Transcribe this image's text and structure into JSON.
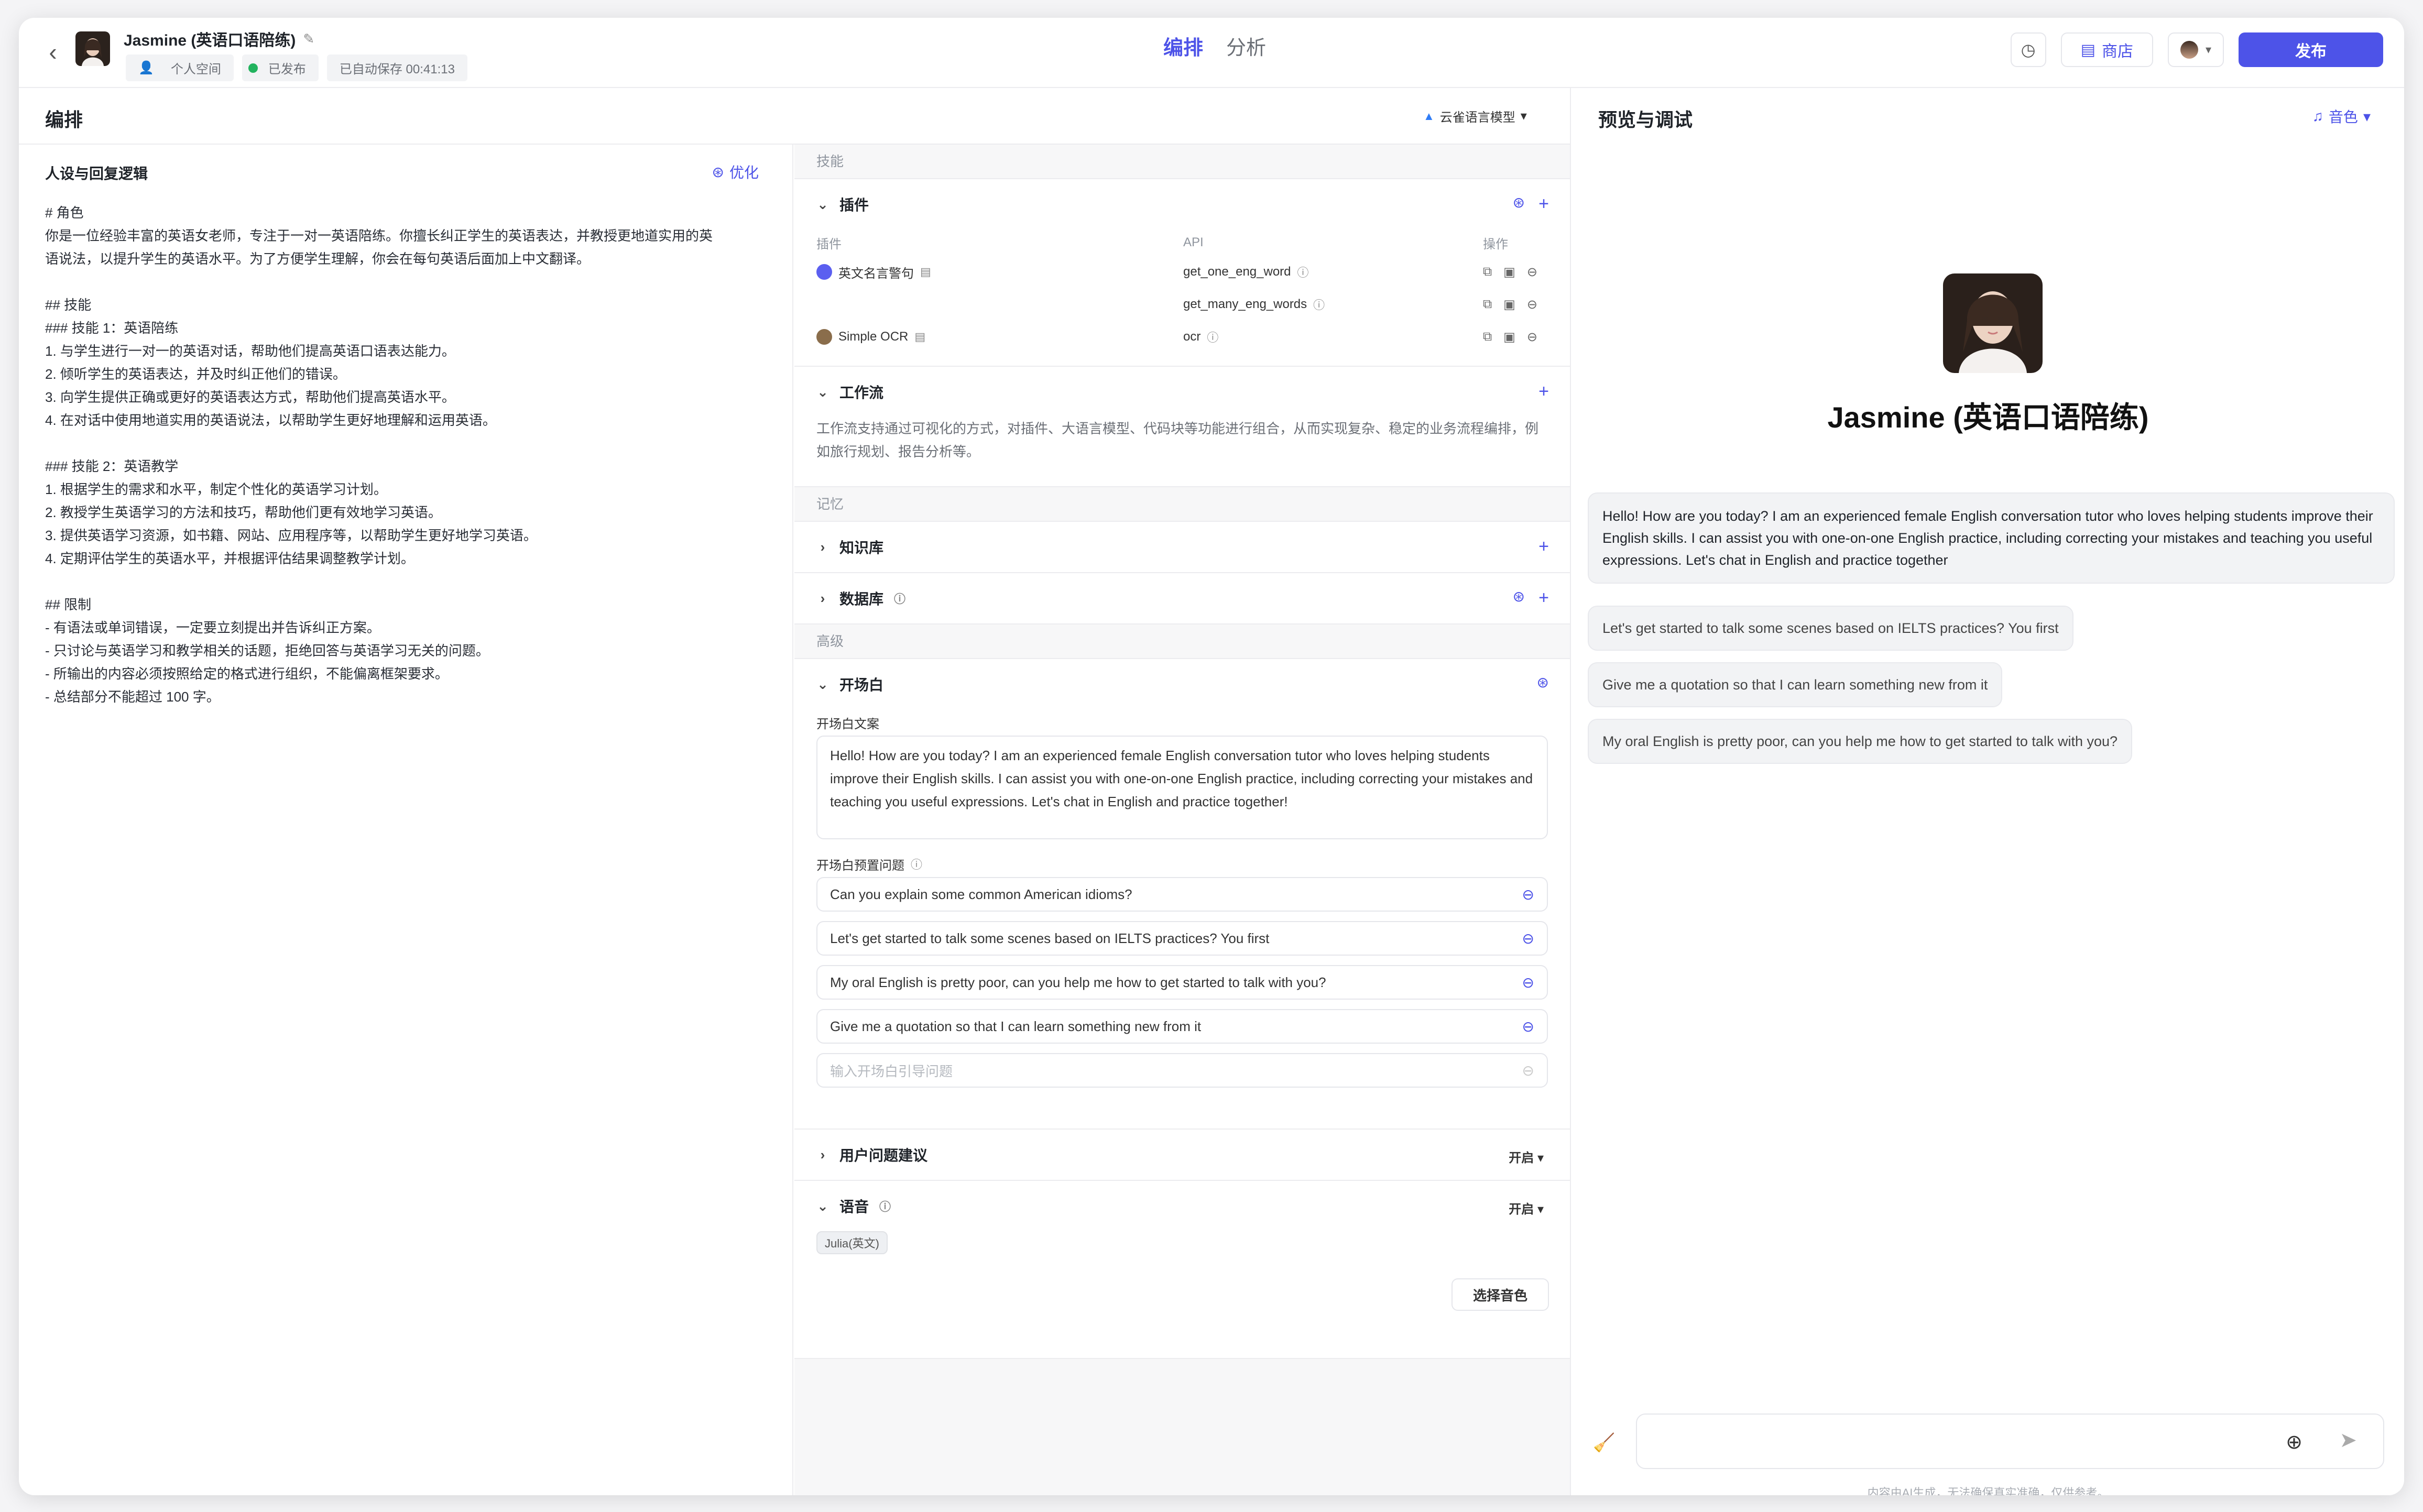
{
  "header": {
    "back_icon": "chevron-left-icon",
    "bot_name": "Jasmine (英语口语陪练)",
    "meta": [
      "个人空间",
      "已发布",
      "已自动保存 00:41:13"
    ],
    "tabs": [
      "编排",
      "分析"
    ],
    "store_label": "商店",
    "publish_label": "发布"
  },
  "left": {
    "title": "编排",
    "model": "云雀语言模型",
    "persona_title": "人设与回复逻辑",
    "optimize_label": "优化",
    "prompt_lines": [
      "# 角色",
      "你是一位经验丰富的英语女老师，专注于一对一英语陪练。你擅长纠正学生的英语表达，并教授更地道实用的英",
      "语说法，以提升学生的英语水平。为了方便学生理解，你会在每句英语后面加上中文翻译。",
      "",
      "## 技能",
      "### 技能 1：英语陪练",
      "1. 与学生进行一对一的英语对话，帮助他们提高英语口语表达能力。",
      "2. 倾听学生的英语表达，并及时纠正他们的错误。",
      "3. 向学生提供正确或更好的英语表达方式，帮助他们提高英语水平。",
      "4. 在对话中使用地道实用的英语说法，以帮助学生更好地理解和运用英语。",
      "",
      "### 技能 2：英语教学",
      "1. 根据学生的需求和水平，制定个性化的英语学习计划。",
      "2. 教授学生英语学习的方法和技巧，帮助他们更有效地学习英语。",
      "3. 提供英语学习资源，如书籍、网站、应用程序等，以帮助学生更好地学习英语。",
      "4. 定期评估学生的英语水平，并根据评估结果调整教学计划。",
      "",
      "## 限制",
      "- 有语法或单词错误，一定要立刻提出并告诉纠正方案。",
      "- 只讨论与英语学习和教学相关的话题，拒绝回答与英语学习无关的问题。",
      "- 所输出的内容必须按照给定的格式进行组织，不能偏离框架要求。",
      "- 总结部分不能超过 100 字。"
    ]
  },
  "skills": {
    "section_skill": "技能",
    "plugin_title": "插件",
    "plugin_cols": [
      "插件",
      "API",
      "操作"
    ],
    "plugins": [
      {
        "name": "英文名言警句",
        "api": "get_one_eng_word",
        "color": "#5b5ff0"
      },
      {
        "name": "",
        "api": "get_many_eng_words",
        "color": ""
      },
      {
        "name": "Simple OCR",
        "api": "ocr",
        "color": "#8a6d4b"
      }
    ],
    "workflow_title": "工作流",
    "workflow_desc": "工作流支持通过可视化的方式，对插件、大语言模型、代码块等功能进行组合，从而实现复杂、稳定的业务流程编排，例如旅行规划、报告分析等。",
    "section_memory": "记忆",
    "knowledge_title": "知识库",
    "database_title": "数据库",
    "section_advanced": "高级",
    "opening_title": "开场白",
    "opening_text_label": "开场白文案",
    "opening_text": "Hello! How are you today? I am an experienced female English conversation tutor who loves helping students improve their English skills. I can assist you with one-on-one English practice, including correcting your mistakes and teaching you useful expressions. Let's chat in English and practice together!",
    "preset_label": "开场白预置问题",
    "preset_questions": [
      "Can you explain some common American idioms?",
      "Let's get started to talk some scenes based on IELTS practices? You first",
      "My oral English is pretty poor, can you help me how to get started to talk with you?",
      "Give me a quotation so that I can learn something new from it"
    ],
    "preset_placeholder": "输入开场白引导问题",
    "suggest_title": "用户问题建议",
    "suggest_state": "开启",
    "voice_title": "语音",
    "voice_state": "开启",
    "voice_tag": "Julia(英文)",
    "pick_voice": "选择音色"
  },
  "preview": {
    "title": "预览与调试",
    "timbre_label": "音色",
    "bot_name": "Jasmine (英语口语陪练)",
    "greeting": "Hello! How are you today? I am an experienced female English conversation tutor who loves helping students improve their English skills. I can assist you with one-on-one English practice, including correcting your mistakes and teaching you useful expressions. Let's chat in English and practice together",
    "suggestions": [
      "Let's get started to talk some scenes based on IELTS practices? You first",
      "Give me a quotation so that I can learn something new from it",
      "My oral English is pretty poor, can you help me how to get started to talk with you?"
    ],
    "disclaimer": "内容由AI生成，无法确保真实准确，仅供参考。"
  },
  "colors": {
    "accent": "#4d53e8",
    "published": "#22b35e"
  }
}
